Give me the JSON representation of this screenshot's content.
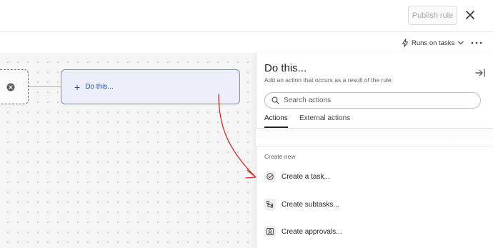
{
  "header": {
    "publish_label": "Publish rule"
  },
  "toolbar": {
    "runs_label": "Runs on tasks"
  },
  "canvas": {
    "do_node_label": "Do this..."
  },
  "panel": {
    "title": "Do this...",
    "subtitle": "Add an action that occurs as a result of the rule.",
    "search_placeholder": "Search actions",
    "tabs": [
      {
        "label": "Actions",
        "active": true
      },
      {
        "label": "External actions",
        "active": false
      }
    ],
    "section_label": "Create new",
    "actions": [
      {
        "label": "Create a task...",
        "icon": "task-check-icon"
      },
      {
        "label": "Create subtasks...",
        "icon": "subtasks-icon"
      },
      {
        "label": "Create approvals...",
        "icon": "approval-icon"
      }
    ]
  },
  "colors": {
    "node_border": "#6a8ed6",
    "node_fill": "#eceff9",
    "node_text": "#2e4f9e",
    "annotation_arrow": "#d42b2b"
  }
}
